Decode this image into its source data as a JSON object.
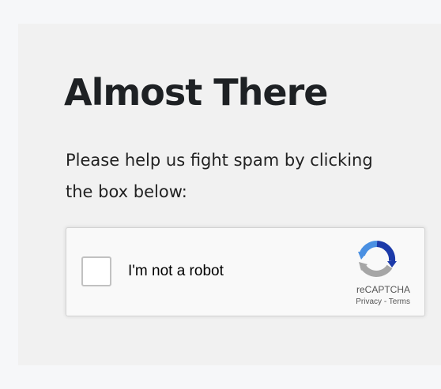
{
  "heading": "Almost There",
  "description": "Please help us fight spam by clicking the box below:",
  "captcha": {
    "checkbox_label": "I'm not a robot",
    "brand": "reCAPTCHA",
    "privacy_link": "Privacy",
    "separator": " - ",
    "terms_link": "Terms",
    "checked": false,
    "logo_icon": "recaptcha-logo-icon",
    "colors": {
      "blue": "#1c3aa9",
      "light_blue": "#4a90e2",
      "gray": "#a6a6a6"
    }
  }
}
